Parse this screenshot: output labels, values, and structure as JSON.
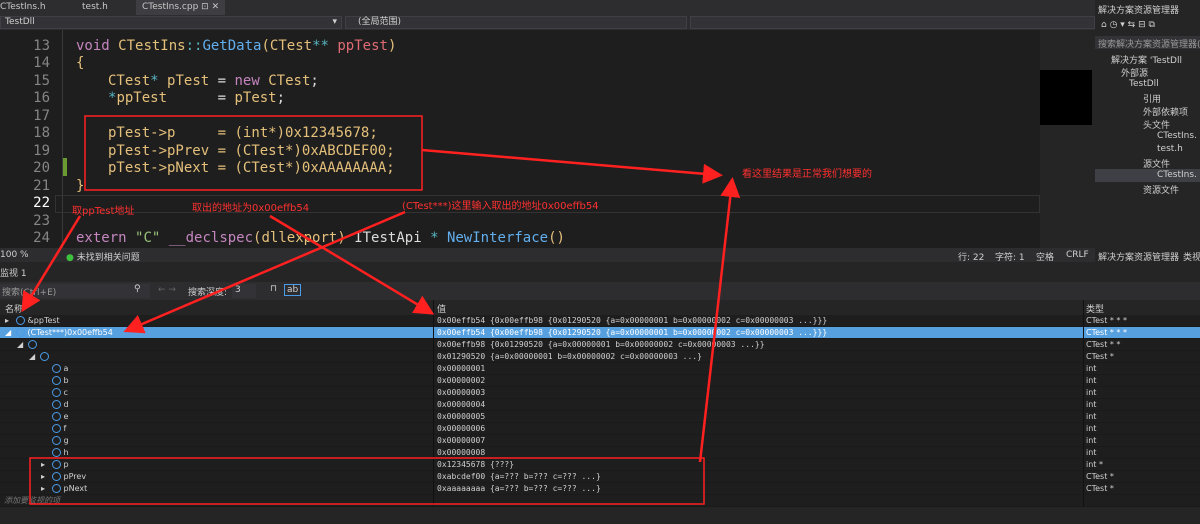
{
  "tabs": [
    {
      "label": "CTestIns.h"
    },
    {
      "label": "test.h"
    },
    {
      "label": "CTestIns.cpp",
      "active": true
    }
  ],
  "nav": {
    "project": "TestDll",
    "scope": "(全局范围)"
  },
  "code": {
    "lines": [
      {
        "n": "13"
      },
      {
        "n": "14"
      },
      {
        "n": "15"
      },
      {
        "n": "16"
      },
      {
        "n": "17"
      },
      {
        "n": "18"
      },
      {
        "n": "19"
      },
      {
        "n": "20"
      },
      {
        "n": "21"
      },
      {
        "n": "22"
      },
      {
        "n": "23"
      },
      {
        "n": "24"
      }
    ],
    "t13": [
      "void",
      "CTestIns",
      "::",
      "GetData",
      "(",
      "CTest",
      "**",
      "ppTest",
      ")"
    ],
    "t14": "{",
    "t15": [
      "CTest",
      "*",
      "pTest",
      "=",
      "new",
      "CTest",
      ";"
    ],
    "t16": [
      "*",
      "ppTest",
      "=",
      "pTest",
      ";"
    ],
    "t18": [
      "pTest->p",
      "=",
      "(int*)",
      "0x12345678",
      ";"
    ],
    "t19": [
      "pTest->pPrev",
      "=",
      "(CTest*)",
      "0xABCDEF00",
      ";"
    ],
    "t20": [
      "pTest->pNext",
      "=",
      "(CTest*)",
      "0xAAAAAAAA",
      ";"
    ],
    "t21": "}",
    "t24": [
      "extern",
      "\"C\"",
      "__declspec",
      "(dllexport)",
      "ITestApi",
      "*",
      "NewInterface",
      "()"
    ]
  },
  "status": {
    "zoom": "100 %",
    "issues": "未找到相关问题",
    "line": "行: 22",
    "char": "字符: 1",
    "spaces": "空格",
    "eol": "CRLF"
  },
  "solution": {
    "title": "解决方案资源管理器",
    "search": "搜索解决方案资源管理器(C",
    "tabs": [
      "解决方案资源管理器",
      "类视"
    ],
    "tree": [
      "解决方案 'TestDll",
      "外部源",
      "TestDll",
      "引用",
      "外部依赖项",
      "头文件",
      "CTestIns.",
      "test.h",
      "源文件",
      "CTestIns.",
      "资源文件"
    ]
  },
  "watch": {
    "title": "监视 1",
    "search_placeholder": "搜索(Ctrl+E)",
    "depth_label": "搜索深度:",
    "depth": "3",
    "cols": {
      "name": "名称",
      "value": "值",
      "type": "类型"
    },
    "rows": [
      {
        "name": "&ppTest",
        "value": "0x00effb54 {0x00effb98 {0x01290520 {a=0x00000001 b=0x00000002 c=0x00000003 ...}}}",
        "type": "CTest * * *"
      },
      {
        "name": "(CTest***)0x00effb54",
        "value": "0x00effb54 {0x00effb98 {0x01290520 {a=0x00000001 b=0x00000002 c=0x00000003 ...}}}",
        "type": "CTest * * *",
        "selected": true
      },
      {
        "name": "",
        "value": "0x00effb98 {0x01290520 {a=0x00000001 b=0x00000002 c=0x00000003 ...}}",
        "type": "CTest * *"
      },
      {
        "name": "",
        "value": "0x01290520 {a=0x00000001 b=0x00000002 c=0x00000003 ...}",
        "type": "CTest *"
      },
      {
        "name": "a",
        "value": "0x00000001",
        "type": "int"
      },
      {
        "name": "b",
        "value": "0x00000002",
        "type": "int"
      },
      {
        "name": "c",
        "value": "0x00000003",
        "type": "int"
      },
      {
        "name": "d",
        "value": "0x00000004",
        "type": "int"
      },
      {
        "name": "e",
        "value": "0x00000005",
        "type": "int"
      },
      {
        "name": "f",
        "value": "0x00000006",
        "type": "int"
      },
      {
        "name": "g",
        "value": "0x00000007",
        "type": "int"
      },
      {
        "name": "h",
        "value": "0x00000008",
        "type": "int"
      },
      {
        "name": "p",
        "value": "0x12345678 {???}",
        "type": "int *"
      },
      {
        "name": "pPrev",
        "value": "0xabcdef00 {a=??? b=??? c=??? ...}",
        "type": "CTest *"
      },
      {
        "name": "pNext",
        "value": "0xaaaaaaaa {a=??? b=??? c=??? ...}",
        "type": "CTest *"
      }
    ],
    "add_placeholder": "添加要监视的项"
  },
  "annotations": {
    "a1": "取ppTest地址",
    "a2": "取出的地址为0x00effb54",
    "a3": "(CTest***)这里输入取出的地址0x00effb54",
    "a4": "看这里结果是正常我们想要的"
  },
  "colors": {
    "annotation": "#ff2020",
    "selection": "#56a0e0"
  }
}
